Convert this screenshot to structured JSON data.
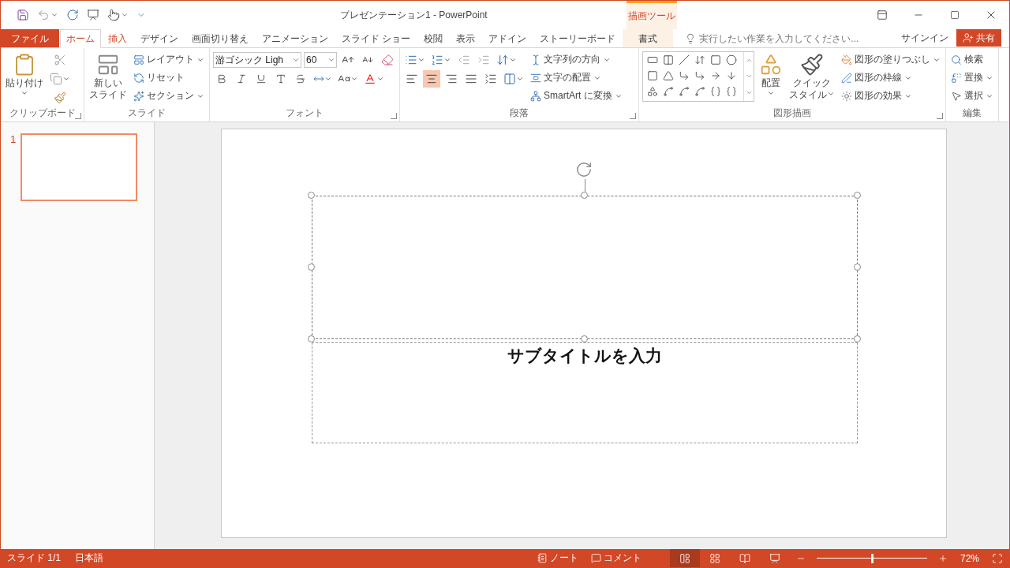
{
  "window": {
    "title": "プレゼンテーション1 - PowerPoint",
    "context_label": "描画ツール"
  },
  "tabs": [
    {
      "label": "ファイル",
      "kind": "file",
      "selected": false,
      "hovered": false
    },
    {
      "label": "ホーム",
      "kind": "tab",
      "selected": true,
      "hovered": false
    },
    {
      "label": "挿入",
      "kind": "tab",
      "selected": false,
      "hovered": true
    },
    {
      "label": "デザイン",
      "kind": "tab",
      "selected": false,
      "hovered": false
    },
    {
      "label": "画面切り替え",
      "kind": "tab",
      "selected": false,
      "hovered": false
    },
    {
      "label": "アニメーション",
      "kind": "tab",
      "selected": false,
      "hovered": false
    },
    {
      "label": "スライド ショー",
      "kind": "tab",
      "selected": false,
      "hovered": false
    },
    {
      "label": "校閲",
      "kind": "tab",
      "selected": false,
      "hovered": false
    },
    {
      "label": "表示",
      "kind": "tab",
      "selected": false,
      "hovered": false
    },
    {
      "label": "アドイン",
      "kind": "tab",
      "selected": false,
      "hovered": false
    },
    {
      "label": "ストーリーボード",
      "kind": "tab",
      "selected": false,
      "hovered": false
    },
    {
      "label": "書式",
      "kind": "contextual",
      "selected": false,
      "hovered": false
    }
  ],
  "tell_me": {
    "placeholder": "実行したい作業を入力してください..."
  },
  "sign_in": "サインイン",
  "share": "共有",
  "ribbon": {
    "clipboard": {
      "paste": "貼り付け",
      "label": "クリップボード"
    },
    "slides": {
      "new_slide": [
        "新しい",
        "スライド"
      ],
      "commands": [
        "レイアウト",
        "リセット",
        "セクション"
      ],
      "label": "スライド"
    },
    "font": {
      "name": "游ゴシック Ligh",
      "size": "60",
      "label": "フォント"
    },
    "paragraph": {
      "alignments": [
        {
          "kind": "left",
          "selected": false
        },
        {
          "kind": "center",
          "selected": true
        },
        {
          "kind": "right",
          "selected": false
        },
        {
          "kind": "justify",
          "selected": false
        },
        {
          "kind": "distributed",
          "selected": false
        }
      ],
      "commands": [
        "文字列の方向",
        "文字の配置",
        "SmartArt に変換"
      ],
      "label": "段落"
    },
    "drawing": {
      "arrange": "配置",
      "quick_style": [
        "クイック",
        "スタイル"
      ],
      "commands": [
        "図形の塗りつぶし",
        "図形の枠線",
        "図形の効果"
      ],
      "label": "図形描画"
    },
    "editing": {
      "commands": [
        "検索",
        "置換",
        "選択"
      ],
      "label": "編集"
    }
  },
  "thumbnails": [
    {
      "number": "1",
      "selected": true
    }
  ],
  "slide": {
    "title_selected": true,
    "subtitle": "サブタイトルを入力"
  },
  "status_bar": {
    "slide": "スライド 1/1",
    "language": "日本語",
    "notes": "ノート",
    "comments": "コメント",
    "views": [
      {
        "kind": "normal",
        "selected": true
      },
      {
        "kind": "sorter",
        "selected": false
      },
      {
        "kind": "reading",
        "selected": false
      },
      {
        "kind": "show",
        "selected": false
      }
    ],
    "zoom": {
      "level": 0.5,
      "reading": "72%"
    }
  }
}
